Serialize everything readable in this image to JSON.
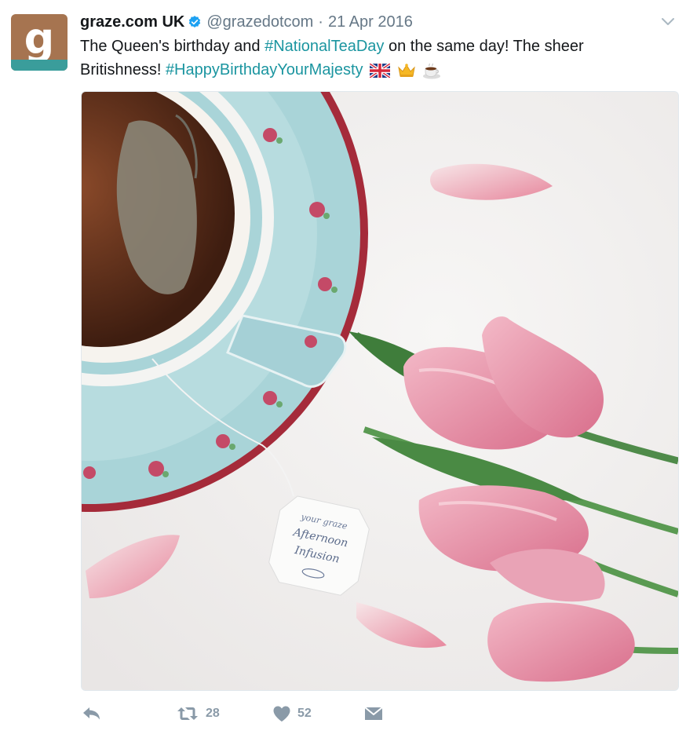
{
  "author": {
    "avatar_letter": "g",
    "display_name": "graze.com UK",
    "handle": "@grazedotcom",
    "separator": "·",
    "date": "21 Apr 2016",
    "verified": true
  },
  "tweet": {
    "text_1": "The Queen's birthday and ",
    "hashtag_1": "#NationalTeaDay",
    "text_2": " on the same day! The sheer Britishness! ",
    "hashtag_2": "#HappyBirthdayYourMajesty",
    "emojis": [
      "uk-flag-icon",
      "crown-icon",
      "coffee-cup-icon"
    ]
  },
  "media": {
    "tea_tag_line_1": "your graze",
    "tea_tag_line_2": "Afternoon",
    "tea_tag_line_3": "Infusion"
  },
  "actions": {
    "retweet_count": "28",
    "like_count": "52"
  },
  "colors": {
    "hashtag": "#1b95a0",
    "verified_badge": "#1da1f2",
    "action_gray": "#8a9aa8",
    "saucer_blue": "#a9d4d8",
    "tulip_pink": "#e99bb0"
  }
}
